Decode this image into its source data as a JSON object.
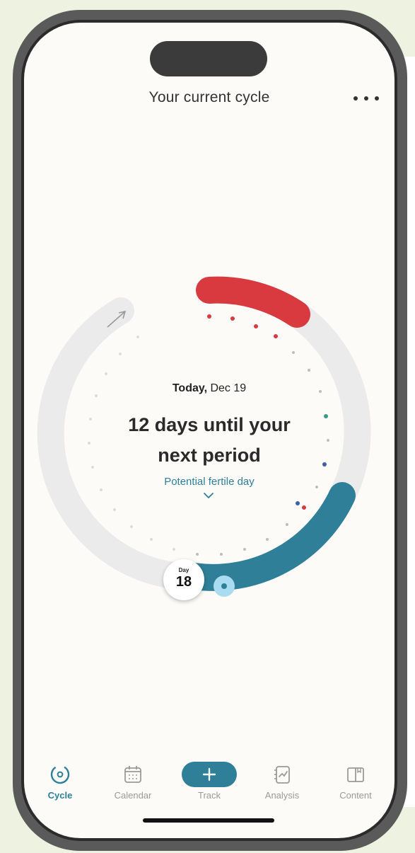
{
  "header": {
    "title": "Your current cycle",
    "more_icon": "more-horizontal-icon"
  },
  "cycle": {
    "today_prefix": "Today,",
    "today_date": "Dec 19",
    "message_line1": "12 days until your",
    "message_line2": "next period",
    "fertile_label": "Potential fertile day",
    "day_label": "Day",
    "day_number": "18"
  },
  "colors": {
    "period": "#d83a3f",
    "fertile": "#2f7f98",
    "track": "#ebebeb",
    "accent": "#2f7f98"
  },
  "nav": {
    "items": [
      {
        "label": "Cycle",
        "icon": "cycle-icon",
        "active": true
      },
      {
        "label": "Calendar",
        "icon": "calendar-icon",
        "active": false
      },
      {
        "label": "Track",
        "icon": "plus-icon",
        "active": false
      },
      {
        "label": "Analysis",
        "icon": "analysis-icon",
        "active": false
      },
      {
        "label": "Content",
        "icon": "book-icon",
        "active": false
      }
    ]
  }
}
